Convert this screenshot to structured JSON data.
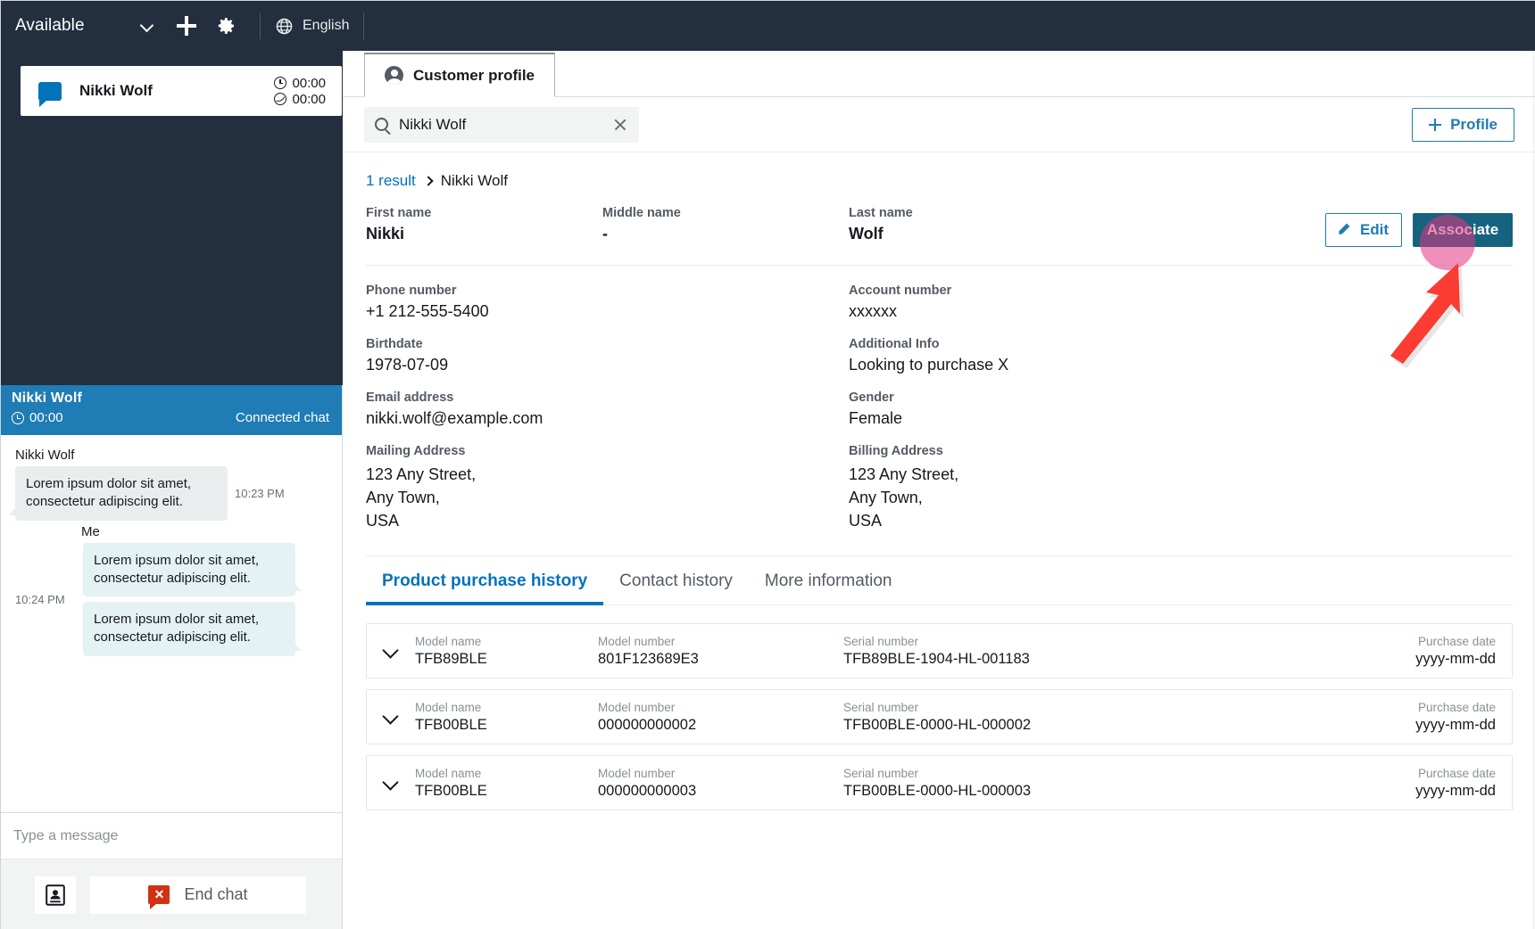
{
  "topbar": {
    "status_label": "Available",
    "chevron_icon": "chevron-down-icon",
    "add_icon": "plus-icon",
    "settings_icon": "gear-icon",
    "language_icon": "globe-icon",
    "language_label": "English"
  },
  "contact_list": {
    "items": [
      {
        "icon": "chat-bubble-icon",
        "name": "Nikki Wolf",
        "timer_connected": "00:00",
        "timer_hold": "00:00"
      }
    ]
  },
  "chat": {
    "header": {
      "name": "Nikki Wolf",
      "clock_icon": "clock-icon",
      "duration": "00:00",
      "status": "Connected chat"
    },
    "messages": [
      {
        "author": "Nikki Wolf",
        "side": "them",
        "text": "Lorem ipsum dolor sit amet, consectetur adipiscing elit.",
        "time": "10:23 PM"
      },
      {
        "author": "Me",
        "side": "me",
        "text": "Lorem ipsum dolor sit amet, consectetur adipiscing elit.",
        "time": "10:24 PM"
      },
      {
        "author": "",
        "side": "me",
        "text": "Lorem ipsum dolor sit amet, consectetur adipiscing elit.",
        "time": ""
      }
    ],
    "compose_placeholder": "Type a message",
    "footer": {
      "contact_card_icon": "contact-card-icon",
      "end_chat_icon": "end-chat-icon",
      "end_chat_label": "End chat"
    }
  },
  "main": {
    "tab": {
      "icon": "person-icon",
      "label": "Customer profile"
    },
    "search": {
      "icon": "search-icon",
      "value": "Nikki Wolf",
      "placeholder": "Search",
      "clear_icon": "close-icon"
    },
    "profile_button": {
      "icon": "plus-icon",
      "label": "Profile"
    },
    "breadcrumb": {
      "results": "1 result",
      "separator_icon": "chevron-right-icon",
      "current": "Nikki Wolf"
    },
    "name_row": {
      "first_name_label": "First name",
      "first_name_value": "Nikki",
      "middle_name_label": "Middle name",
      "middle_name_value": "-",
      "last_name_label": "Last name",
      "last_name_value": "Wolf",
      "edit_icon": "pencil-icon",
      "edit_label": "Edit",
      "associate_label": "Associate"
    },
    "details_left": [
      {
        "label": "Phone number",
        "value": "+1 212-555-5400"
      },
      {
        "label": "Birthdate",
        "value": "1978-07-09"
      },
      {
        "label": "Email address",
        "value": "nikki.wolf@example.com"
      },
      {
        "label": "Mailing Address",
        "value": "123 Any Street,\nAny Town,\nUSA"
      }
    ],
    "details_right": [
      {
        "label": "Account number",
        "value": "xxxxxx"
      },
      {
        "label": "Additional Info",
        "value": "Looking to purchase X"
      },
      {
        "label": "Gender",
        "value": "Female"
      },
      {
        "label": "Billing Address",
        "value": "123 Any Street,\nAny Town,\nUSA"
      }
    ],
    "subtabs": [
      {
        "label": "Product purchase history",
        "active": true
      },
      {
        "label": "Contact history",
        "active": false
      },
      {
        "label": "More information",
        "active": false
      }
    ],
    "purchase_table": {
      "headers": {
        "model_name": "Model name",
        "model_number": "Model number",
        "serial_number": "Serial number",
        "purchase_date": "Purchase date"
      },
      "rows": [
        {
          "expand_icon": "chevron-down-icon",
          "model_name": "TFB89BLE",
          "model_number": "801F123689E3",
          "serial_number": "TFB89BLE-1904-HL-001183",
          "purchase_date": "yyyy-mm-dd"
        },
        {
          "expand_icon": "chevron-down-icon",
          "model_name": "TFB00BLE",
          "model_number": "000000000002",
          "serial_number": "TFB00BLE-0000-HL-000002",
          "purchase_date": "yyyy-mm-dd"
        },
        {
          "expand_icon": "chevron-down-icon",
          "model_name": "TFB00BLE",
          "model_number": "000000000003",
          "serial_number": "TFB00BLE-0000-HL-000003",
          "purchase_date": "yyyy-mm-dd"
        }
      ]
    }
  },
  "annotation": {
    "highlight_color": "#e23482",
    "arrow_color": "#fa3c32",
    "target": "Associate"
  },
  "colors": {
    "topbar_bg": "#232f3e",
    "panel_bg": "#232f3e",
    "chat_header_bg": "#1f7cb4",
    "link": "#0073bb",
    "accent_button": "#16637f",
    "outline_button": "#1f7cb4",
    "bubble_them": "#eaeded",
    "bubble_me": "#e4f2f3",
    "end_chat_red": "#d13212"
  }
}
